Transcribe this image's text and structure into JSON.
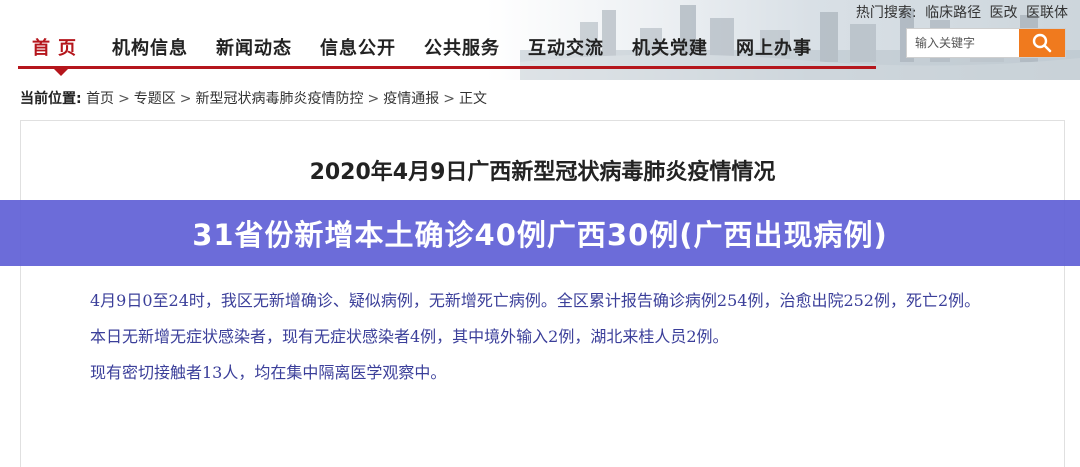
{
  "header": {
    "hot_search_label": "热门搜索:",
    "hot_links": [
      "临床路径",
      "医改",
      "医联体"
    ],
    "nav_items": [
      "首页",
      "机构信息",
      "新闻动态",
      "信息公开",
      "公共服务",
      "互动交流",
      "机关党建",
      "网上办事"
    ],
    "search_placeholder": "输入关键字",
    "search_icon": "magnifier-icon"
  },
  "breadcrumb": {
    "label": "当前位置:",
    "items": [
      "首页",
      "专题区",
      "新型冠状病毒肺炎疫情防控",
      "疫情通报",
      "正文"
    ]
  },
  "article": {
    "title": "2020年4月9日广西新型冠状病毒肺炎疫情情况",
    "paragraphs": [
      "4月9日0至24时，我区无新增确诊、疑似病例，无新增死亡病例。全区累计报告确诊病例254例，治愈出院252例，死亡2例。",
      "本日无新增无症状感染者，现有无症状感染者4例，其中境外输入2例，湖北来桂人员2例。",
      "现有密切接触者13人，均在集中隔离医学观察中。"
    ]
  },
  "banner": {
    "text": "31省份新增本土确诊40例广西30例(广西出现病例)"
  },
  "colors": {
    "nav_active": "#b5161c",
    "search_button": "#f07a1e",
    "banner_bg": "#6060d6",
    "body_text": "#3b3f9a"
  }
}
